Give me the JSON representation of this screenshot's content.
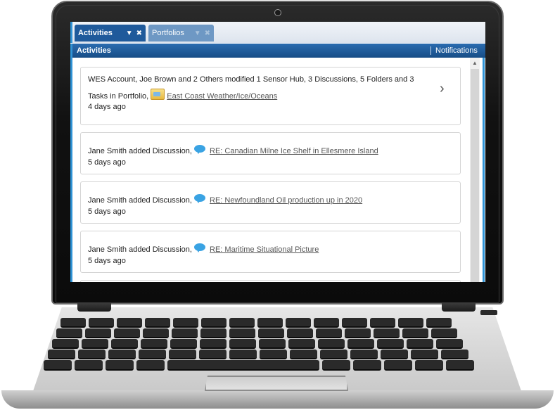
{
  "tabs": [
    {
      "label": "Activities",
      "active": true
    },
    {
      "label": "Portfolios",
      "active": false
    }
  ],
  "header": {
    "title": "Activities",
    "notifications_label": "Notifications"
  },
  "activities": [
    {
      "text_line1": "WES Account, Joe Brown and 2 Others modified 1 Sensor Hub, 3 Discussions, 5 Folders and 3",
      "text_line2": "Tasks in Portfolio,",
      "link": "East Coast Weather/Ice/Oceans",
      "icon": "folder-icon",
      "time": "4 days ago"
    },
    {
      "text": "Jane Smith added Discussion,",
      "link": "RE: Canadian Milne Ice Shelf in Ellesmere Island",
      "icon": "discussion-bubble-icon",
      "time": "5 days ago"
    },
    {
      "text": "Jane Smith added Discussion,",
      "link": "RE: Newfoundland Oil production up in 2020",
      "icon": "discussion-bubble-icon",
      "time": "5 days ago"
    },
    {
      "text": "Jane Smith added Discussion,",
      "link": "RE: Maritime Situational Picture",
      "icon": "discussion-bubble-icon",
      "time": "5 days ago"
    }
  ],
  "colors": {
    "accent": "#1f5a9b",
    "border_accent": "#2f93d6",
    "discussion_icon": "#3aa3e3"
  }
}
